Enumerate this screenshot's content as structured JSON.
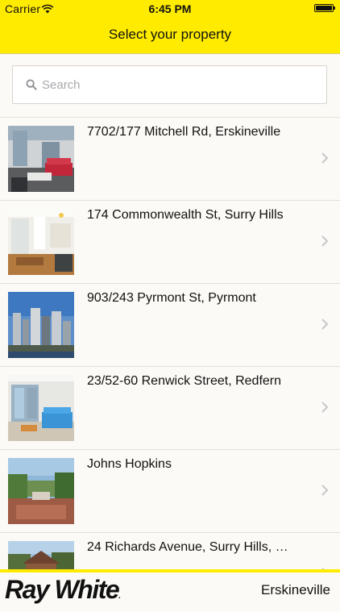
{
  "status_bar": {
    "carrier": "Carrier",
    "time": "6:45 PM",
    "battery_level": 1.0
  },
  "nav": {
    "title": "Select your property"
  },
  "search": {
    "placeholder": "Search",
    "value": "",
    "icon": "search-icon"
  },
  "properties": [
    {
      "address": "7702/177 Mitchell Rd, Erskineville",
      "photo": "apartment-living-room"
    },
    {
      "address": "174 Commonwealth St, Surry Hills",
      "photo": "open-plan-kitchen"
    },
    {
      "address": "903/243 Pyrmont St, Pyrmont",
      "photo": "city-skyline"
    },
    {
      "address": "23/52-60 Renwick Street, Redfern",
      "photo": "living-room-balcony"
    },
    {
      "address": "Johns Hopkins",
      "photo": "garden-courtyard"
    },
    {
      "address": "24 Richards Avenue, Surry Hills, …",
      "photo": "house-exterior"
    }
  ],
  "footer": {
    "brand": "Ray White",
    "brand_mark": ".",
    "office": "Erskineville"
  },
  "colors": {
    "accent_yellow": "#ffeb00",
    "background": "#fbfaf6",
    "text": "#111111",
    "placeholder": "#a9a9ae",
    "chevron": "#c7c7cc"
  }
}
